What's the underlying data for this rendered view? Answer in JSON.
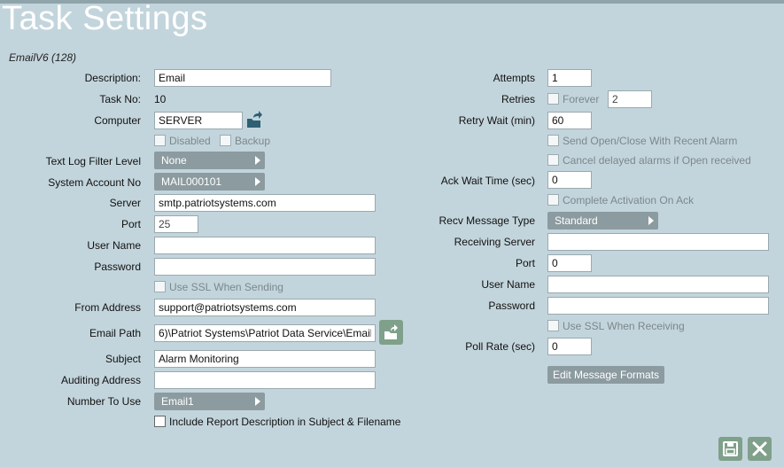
{
  "page": {
    "title": "Task Settings",
    "subtitle": "EmailV6 (128)"
  },
  "left": {
    "description": {
      "label": "Description:",
      "value": "Email"
    },
    "task_no": {
      "label": "Task No:",
      "value": "10"
    },
    "computer": {
      "label": "Computer",
      "value": "SERVER"
    },
    "disabled": {
      "label": "Disabled",
      "checked": false
    },
    "backup": {
      "label": "Backup",
      "checked": false
    },
    "text_log_filter": {
      "label": "Text Log Filter Level",
      "value": "None"
    },
    "system_account": {
      "label": "System Account No",
      "value": "MAIL000101"
    },
    "server": {
      "label": "Server",
      "value": "smtp.patriotsystems.com"
    },
    "port": {
      "label": "Port",
      "value": "25"
    },
    "user_name": {
      "label": "User Name",
      "value": ""
    },
    "password": {
      "label": "Password",
      "value": ""
    },
    "use_ssl_sending": {
      "label": "Use SSL When Sending",
      "checked": false
    },
    "from_address": {
      "label": "From Address",
      "value": "support@patriotsystems.com"
    },
    "email_path": {
      "label": "Email Path",
      "value": "6)\\Patriot Systems\\Patriot Data Service\\Email"
    },
    "subject": {
      "label": "Subject",
      "value": "Alarm Monitoring"
    },
    "auditing_address": {
      "label": "Auditing Address",
      "value": ""
    },
    "number_to_use": {
      "label": "Number To Use",
      "value": "Email1"
    },
    "include_report": {
      "label": "Include Report Description in Subject & Filename",
      "checked": false
    }
  },
  "right": {
    "attempts": {
      "label": "Attempts",
      "value": "1"
    },
    "retries": {
      "label": "Retries",
      "forever_label": "Forever",
      "forever_checked": false,
      "value": "2"
    },
    "retry_wait": {
      "label": "Retry Wait (min)",
      "value": "60"
    },
    "send_open_close": {
      "label": "Send Open/Close With Recent Alarm",
      "checked": false
    },
    "cancel_delayed": {
      "label": "Cancel delayed alarms if Open received",
      "checked": false
    },
    "ack_wait": {
      "label": "Ack Wait Time (sec)",
      "value": "0"
    },
    "complete_activation": {
      "label": "Complete Activation On Ack",
      "checked": false
    },
    "recv_message_type": {
      "label": "Recv Message Type",
      "value": "Standard"
    },
    "receiving_server": {
      "label": "Receiving Server",
      "value": ""
    },
    "port": {
      "label": "Port",
      "value": "0"
    },
    "user_name": {
      "label": "User Name",
      "value": ""
    },
    "password": {
      "label": "Password",
      "value": ""
    },
    "use_ssl_receiving": {
      "label": "Use SSL When Receiving",
      "checked": false
    },
    "poll_rate": {
      "label": "Poll Rate (sec)",
      "value": "0"
    },
    "edit_formats_label": "Edit Message Formats"
  },
  "icons": {
    "computer_browse": "folder-arrow-icon",
    "path_browse": "folder-open-icon",
    "save": "save-icon",
    "close": "close-icon"
  },
  "colors": {
    "background": "#c3d5dc",
    "select": "#8c9ba0",
    "action": "#7fa08a"
  }
}
